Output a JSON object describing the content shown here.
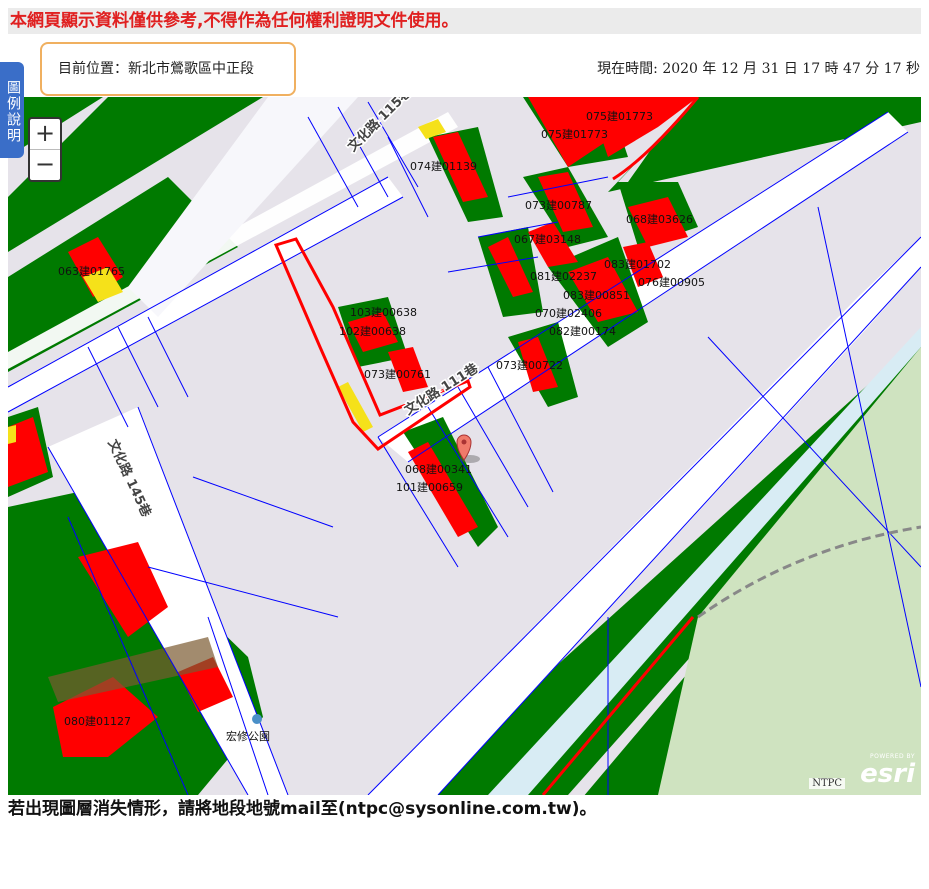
{
  "notice": "本網頁顯示資料僅供參考,不得作為任何權利證明文件使用。",
  "location": "目前位置：新北市鶯歌區中正段",
  "clock": "現在時間: 2020 年 12 月 31 日 17 時 47 分 17 秒",
  "legend_button": "圖例說明",
  "zoom": {
    "in": "+",
    "out": "−"
  },
  "roads": [
    "文化路 115巷",
    "文化路 145巷",
    "文化路 111巷"
  ],
  "parcels": [
    "075建01773",
    "075建01773",
    "074建01139",
    "073建00787",
    "068建03626",
    "067建03148",
    "063建01765",
    "081建02237",
    "083建01702",
    "076建00905",
    "083建00851",
    "103建00638",
    "070建02406",
    "102建00638",
    "082建00174",
    "073建00761",
    "073建00722",
    "068建00341",
    "101建00659",
    "080建01127"
  ],
  "poi": "宏修公園",
  "attribution": {
    "ntpc": "NTPC",
    "powered": "POWERED BY",
    "esri": "esri"
  },
  "footer": "若出現圖層消失情形，請將地段地號mail至(ntpc@sysonline.com.tw)。",
  "colors": {
    "green_zone": "#007a00",
    "building": "#ff0000",
    "yellow": "#f5e11a",
    "park": "#cfe3c0",
    "parcel_line": "#0000ff",
    "highlight": "#ff0000"
  }
}
